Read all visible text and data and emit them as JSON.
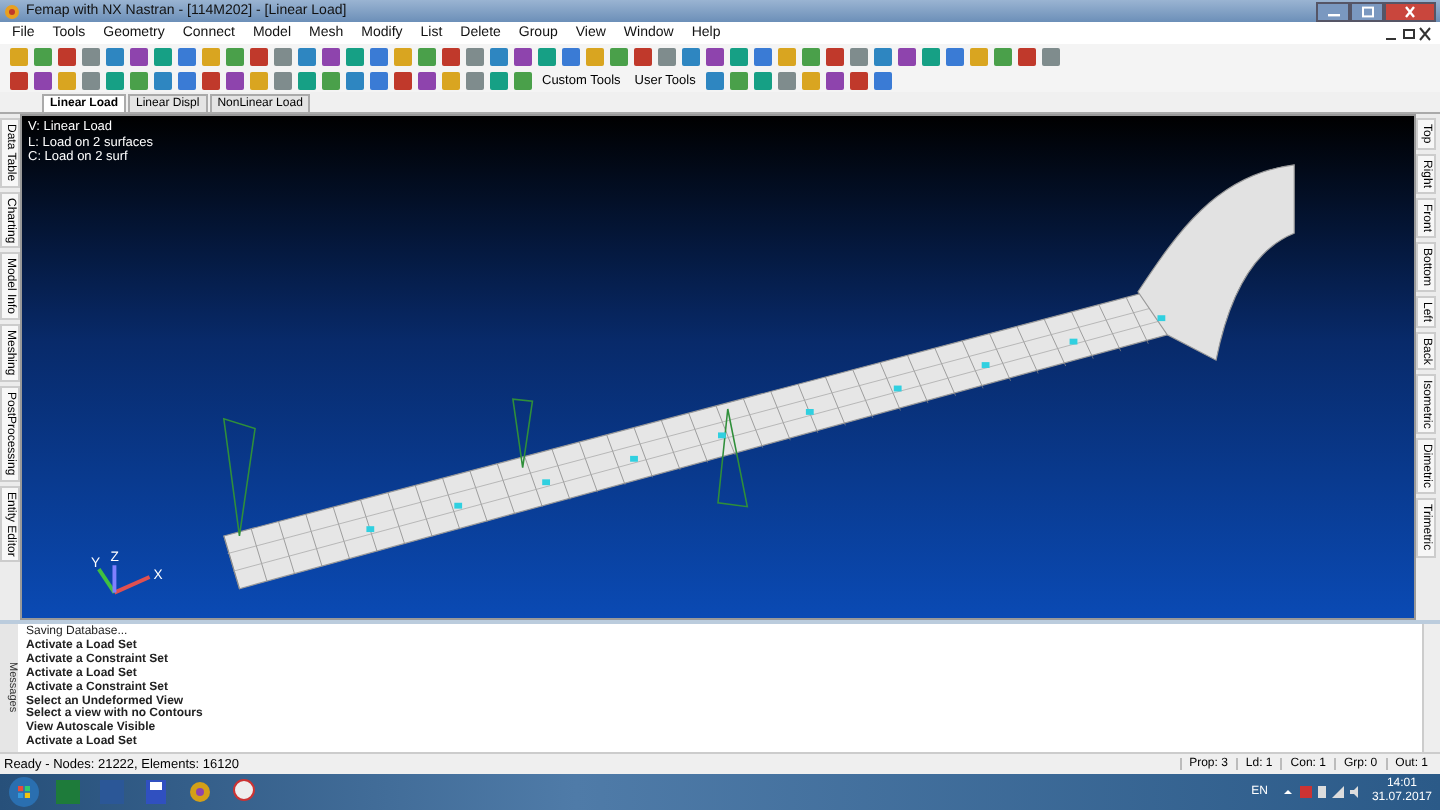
{
  "window": {
    "title": "Femap with NX Nastran - [114M202] - [Linear Load]"
  },
  "menu": [
    "File",
    "Tools",
    "Geometry",
    "Connect",
    "Model",
    "Mesh",
    "Modify",
    "List",
    "Delete",
    "Group",
    "View",
    "Window",
    "Help"
  ],
  "toolbar": {
    "custom_tools": "Custom Tools",
    "user_tools": "User Tools"
  },
  "doc_tabs": [
    {
      "label": "Linear Load",
      "selected": true
    },
    {
      "label": "Linear Displ",
      "selected": false
    },
    {
      "label": "NonLinear Load",
      "selected": false
    }
  ],
  "left_panes": [
    "Data Table",
    "Charting",
    "Model Info",
    "Meshing",
    "PostProcessing",
    "Entity Editor"
  ],
  "view_info": [
    "V: Linear Load",
    "L: Load on 2 surfaces",
    "C: Load on 2 surf"
  ],
  "axes": [
    "X",
    "Y",
    "Z"
  ],
  "view_buttons": [
    "Top",
    "Right",
    "Front",
    "Bottom",
    "Left",
    "Back",
    "Isometric",
    "Dimetric",
    "Trimetric"
  ],
  "messages_label": "Messages",
  "messages": [
    {
      "text": "Saving Database...",
      "bold": false
    },
    {
      "text": "Activate a Load Set",
      "bold": true
    },
    {
      "text": "Activate a Constraint Set",
      "bold": true
    },
    {
      "text": "Activate a Load Set",
      "bold": true
    },
    {
      "text": "Activate a Constraint Set",
      "bold": true
    },
    {
      "text": "Select an Undeformed View",
      "bold": true
    },
    {
      "text": "Select a view with no Contours",
      "bold": true
    },
    {
      "text": "View Autoscale Visible",
      "bold": true
    },
    {
      "text": "Activate a Load Set",
      "bold": true
    }
  ],
  "status": {
    "text": "Ready - Nodes: 21222,  Elements: 16120",
    "fields": [
      "Prop: 3",
      "Ld: 1",
      "Con: 1",
      "Grp: 0",
      "Out: 1"
    ]
  },
  "taskbar": {
    "language": "EN",
    "time": "14:01",
    "date": "31.07.2017"
  }
}
